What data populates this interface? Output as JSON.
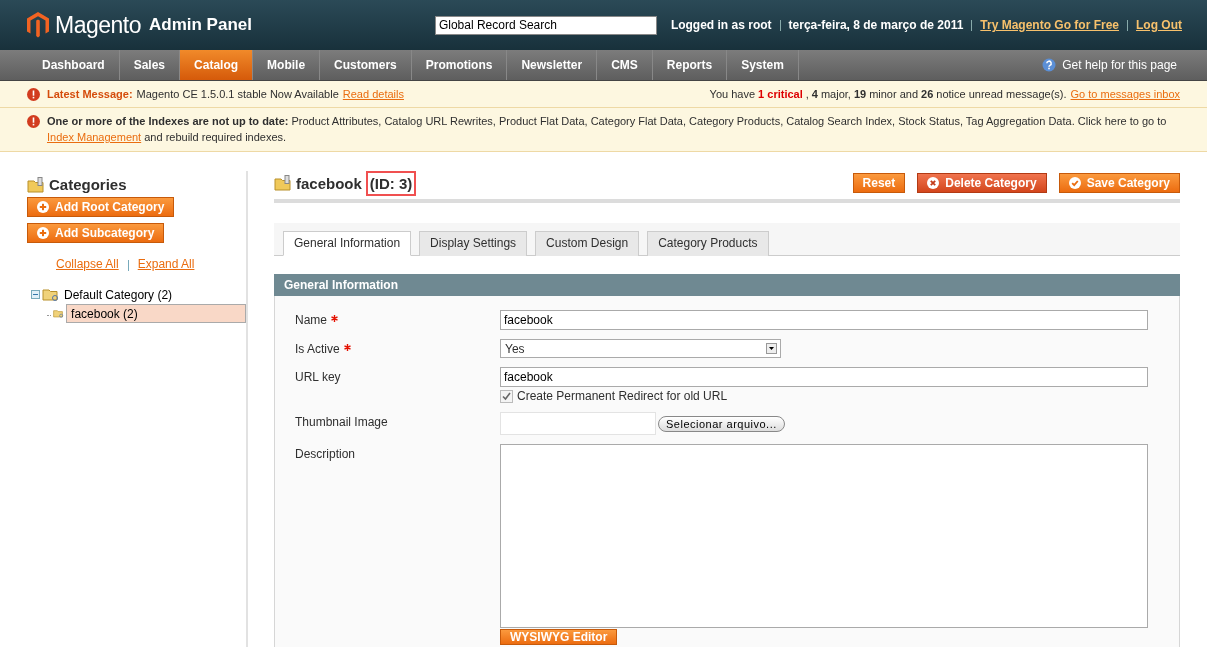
{
  "header": {
    "logo_text": "Magento",
    "logo_suffix": "Admin Panel",
    "search": {
      "placeholder": "Global Record Search"
    },
    "user_info": "Logged in as root",
    "date": "terça-feira, 8 de março de 2011",
    "links": [
      "Try Magento Go for Free",
      "Log Out"
    ]
  },
  "nav": {
    "items": [
      {
        "label": "Dashboard",
        "selected": false
      },
      {
        "label": "Sales",
        "selected": false
      },
      {
        "label": "Catalog",
        "selected": true
      },
      {
        "label": "Mobile",
        "selected": false
      },
      {
        "label": "Customers",
        "selected": false
      },
      {
        "label": "Promotions",
        "selected": false
      },
      {
        "label": "Newsletter",
        "selected": false
      },
      {
        "label": "CMS",
        "selected": false
      },
      {
        "label": "Reports",
        "selected": false
      },
      {
        "label": "System",
        "selected": false
      }
    ],
    "help": "Get help for this page"
  },
  "messages": [
    {
      "label": "Latest Message:",
      "text": "Magento CE 1.5.0.1 stable Now Available",
      "link": "Read details",
      "summary": [
        {
          "kind": "plain",
          "text": "You have"
        },
        {
          "kind": "critical",
          "text": "1 critical"
        },
        {
          "kind": "plain",
          "text": ","
        },
        {
          "kind": "bold",
          "text": "4"
        },
        {
          "kind": "plain",
          "text": "major,"
        },
        {
          "kind": "bold",
          "text": "19"
        },
        {
          "kind": "plain",
          "text": "minor and"
        },
        {
          "kind": "bold",
          "text": "26"
        },
        {
          "kind": "plain",
          "text": "notice unread message(s)."
        }
      ],
      "summary_link": "Go to messages inbox"
    },
    {
      "text": "**One or more of the Indexes are not up to date:** Product Attributes, Catalog URL Rewrites, Product Flat Data, Category Flat Data, Category Products, Catalog Search Index, Stock Status, Tag Aggregation Data. Click here to go to",
      "link": "Index Management",
      "after": "and rebuild required indexes."
    }
  ],
  "sidebar": {
    "title": "Categories",
    "buttons": [
      "Add Root Category",
      "Add Subcategory"
    ],
    "tree_links": [
      "Collapse All",
      "Expand All"
    ],
    "tree": [
      {
        "label": "Default Category (2)",
        "expanded": true,
        "selected": false,
        "children": [
          {
            "label": "facebook (2)",
            "selected": true
          }
        ]
      }
    ]
  },
  "page": {
    "title": "facebook",
    "id_label": "(ID: 3)",
    "buttons": [
      {
        "label": "Reset",
        "kind": "plain"
      },
      {
        "label": "Delete Category",
        "kind": "delete"
      },
      {
        "label": "Save Category",
        "kind": "save"
      }
    ],
    "tabs": [
      {
        "label": "General Information",
        "selected": true
      },
      {
        "label": "Display Settings",
        "selected": false
      },
      {
        "label": "Custom Design",
        "selected": false
      },
      {
        "label": "Category Products",
        "selected": false
      }
    ],
    "section_title": "General Information",
    "fields": [
      {
        "kind": "text",
        "label": "Name",
        "required": true,
        "value": "facebook"
      },
      {
        "kind": "select",
        "label": "Is Active",
        "required": true,
        "value": "Yes"
      },
      {
        "kind": "text",
        "label": "URL key",
        "required": false,
        "value": "facebook",
        "checkbox": {
          "label": "Create Permanent Redirect for old URL",
          "checked": true
        }
      },
      {
        "kind": "file",
        "label": "Thumbnail Image",
        "required": false,
        "button": "Selecionar arquivo..."
      },
      {
        "kind": "textarea",
        "label": "Description",
        "required": false,
        "button": "WYSIWYG Editor"
      }
    ]
  }
}
